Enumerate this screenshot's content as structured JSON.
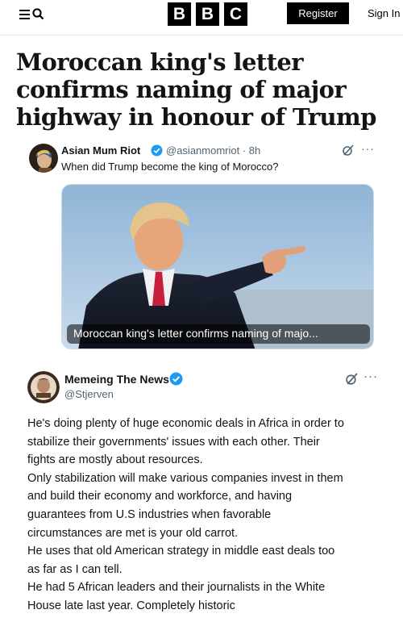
{
  "header": {
    "logo_letters": [
      "B",
      "B",
      "C"
    ],
    "register_label": "Register",
    "signin_label": "Sign In"
  },
  "article": {
    "headline": "Moroccan king's letter confirms naming of major highway in honour of Trump"
  },
  "tweet1": {
    "name": "Asian Mum Riot",
    "handle": "@asianmomriot · 8h",
    "text": "When did Trump become the king of Morocco?",
    "media_caption": "Moroccan king's letter confirms naming of majo...",
    "more_label": "···"
  },
  "tweet2": {
    "name": "Memeing The News",
    "handle": "@Stjerven",
    "more_label": "···",
    "body_lines": [
      "He's doing plenty of huge economic deals in Africa in order to",
      "stabilize their governments' issues with each other. Their",
      "fights are mostly about resources.",
      "Only stabilization will make various companies invest in them",
      "and build their economy and workforce, and having",
      "guarantees from U.S industries when favorable",
      "circumstances are met is your old carrot.",
      "He uses that old American strategy in middle east deals too",
      "as far as I can tell.",
      "He had 5 African leaders and their journalists in the White",
      "House late last year. Completely historic"
    ]
  },
  "colors": {
    "verified": "#1d9bf0",
    "text_secondary": "#536471",
    "bbc_black": "#000000"
  }
}
